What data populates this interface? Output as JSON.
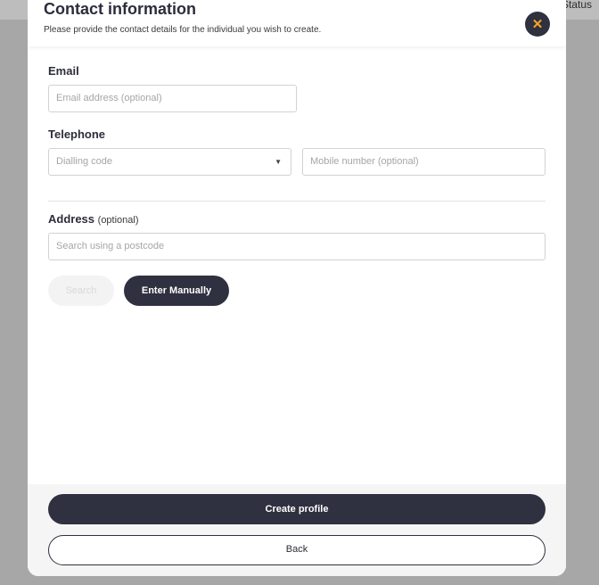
{
  "background": {
    "status_text": "Status"
  },
  "modal": {
    "title": "Contact information",
    "subtitle": "Please provide the contact details for the individual you wish to create.",
    "close_icon": "close-icon"
  },
  "email": {
    "label": "Email",
    "placeholder": "Email address (optional)"
  },
  "telephone": {
    "label": "Telephone",
    "dialling_placeholder": "Dialling code",
    "mobile_placeholder": "Mobile number (optional)"
  },
  "address": {
    "label": "Address",
    "optional_label": "(optional)",
    "placeholder": "Search using a postcode",
    "search_label": "Search",
    "manual_label": "Enter Manually"
  },
  "footer": {
    "create_label": "Create profile",
    "back_label": "Back"
  },
  "colors": {
    "dark": "#2f3040",
    "accent": "#f5a524",
    "overlay": "#a7a7a7"
  }
}
